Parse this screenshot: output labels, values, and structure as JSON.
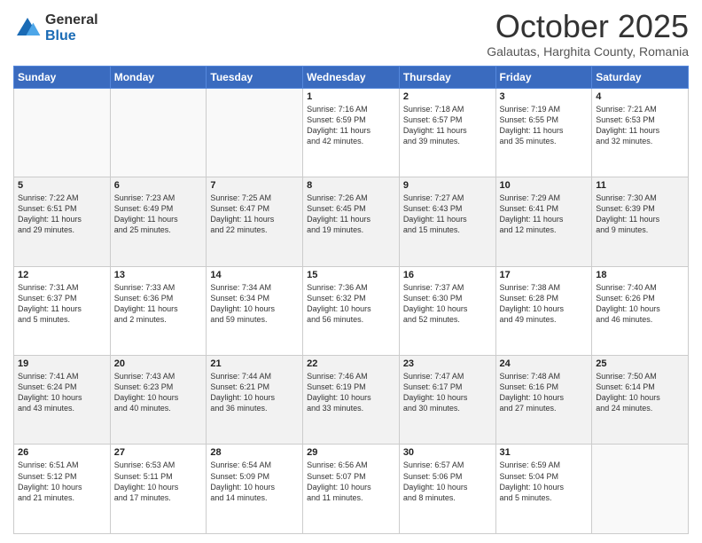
{
  "logo": {
    "general": "General",
    "blue": "Blue"
  },
  "header": {
    "month": "October 2025",
    "location": "Galautas, Harghita County, Romania"
  },
  "weekdays": [
    "Sunday",
    "Monday",
    "Tuesday",
    "Wednesday",
    "Thursday",
    "Friday",
    "Saturday"
  ],
  "weeks": [
    [
      {
        "day": "",
        "info": ""
      },
      {
        "day": "",
        "info": ""
      },
      {
        "day": "",
        "info": ""
      },
      {
        "day": "1",
        "info": "Sunrise: 7:16 AM\nSunset: 6:59 PM\nDaylight: 11 hours\nand 42 minutes."
      },
      {
        "day": "2",
        "info": "Sunrise: 7:18 AM\nSunset: 6:57 PM\nDaylight: 11 hours\nand 39 minutes."
      },
      {
        "day": "3",
        "info": "Sunrise: 7:19 AM\nSunset: 6:55 PM\nDaylight: 11 hours\nand 35 minutes."
      },
      {
        "day": "4",
        "info": "Sunrise: 7:21 AM\nSunset: 6:53 PM\nDaylight: 11 hours\nand 32 minutes."
      }
    ],
    [
      {
        "day": "5",
        "info": "Sunrise: 7:22 AM\nSunset: 6:51 PM\nDaylight: 11 hours\nand 29 minutes."
      },
      {
        "day": "6",
        "info": "Sunrise: 7:23 AM\nSunset: 6:49 PM\nDaylight: 11 hours\nand 25 minutes."
      },
      {
        "day": "7",
        "info": "Sunrise: 7:25 AM\nSunset: 6:47 PM\nDaylight: 11 hours\nand 22 minutes."
      },
      {
        "day": "8",
        "info": "Sunrise: 7:26 AM\nSunset: 6:45 PM\nDaylight: 11 hours\nand 19 minutes."
      },
      {
        "day": "9",
        "info": "Sunrise: 7:27 AM\nSunset: 6:43 PM\nDaylight: 11 hours\nand 15 minutes."
      },
      {
        "day": "10",
        "info": "Sunrise: 7:29 AM\nSunset: 6:41 PM\nDaylight: 11 hours\nand 12 minutes."
      },
      {
        "day": "11",
        "info": "Sunrise: 7:30 AM\nSunset: 6:39 PM\nDaylight: 11 hours\nand 9 minutes."
      }
    ],
    [
      {
        "day": "12",
        "info": "Sunrise: 7:31 AM\nSunset: 6:37 PM\nDaylight: 11 hours\nand 5 minutes."
      },
      {
        "day": "13",
        "info": "Sunrise: 7:33 AM\nSunset: 6:36 PM\nDaylight: 11 hours\nand 2 minutes."
      },
      {
        "day": "14",
        "info": "Sunrise: 7:34 AM\nSunset: 6:34 PM\nDaylight: 10 hours\nand 59 minutes."
      },
      {
        "day": "15",
        "info": "Sunrise: 7:36 AM\nSunset: 6:32 PM\nDaylight: 10 hours\nand 56 minutes."
      },
      {
        "day": "16",
        "info": "Sunrise: 7:37 AM\nSunset: 6:30 PM\nDaylight: 10 hours\nand 52 minutes."
      },
      {
        "day": "17",
        "info": "Sunrise: 7:38 AM\nSunset: 6:28 PM\nDaylight: 10 hours\nand 49 minutes."
      },
      {
        "day": "18",
        "info": "Sunrise: 7:40 AM\nSunset: 6:26 PM\nDaylight: 10 hours\nand 46 minutes."
      }
    ],
    [
      {
        "day": "19",
        "info": "Sunrise: 7:41 AM\nSunset: 6:24 PM\nDaylight: 10 hours\nand 43 minutes."
      },
      {
        "day": "20",
        "info": "Sunrise: 7:43 AM\nSunset: 6:23 PM\nDaylight: 10 hours\nand 40 minutes."
      },
      {
        "day": "21",
        "info": "Sunrise: 7:44 AM\nSunset: 6:21 PM\nDaylight: 10 hours\nand 36 minutes."
      },
      {
        "day": "22",
        "info": "Sunrise: 7:46 AM\nSunset: 6:19 PM\nDaylight: 10 hours\nand 33 minutes."
      },
      {
        "day": "23",
        "info": "Sunrise: 7:47 AM\nSunset: 6:17 PM\nDaylight: 10 hours\nand 30 minutes."
      },
      {
        "day": "24",
        "info": "Sunrise: 7:48 AM\nSunset: 6:16 PM\nDaylight: 10 hours\nand 27 minutes."
      },
      {
        "day": "25",
        "info": "Sunrise: 7:50 AM\nSunset: 6:14 PM\nDaylight: 10 hours\nand 24 minutes."
      }
    ],
    [
      {
        "day": "26",
        "info": "Sunrise: 6:51 AM\nSunset: 5:12 PM\nDaylight: 10 hours\nand 21 minutes."
      },
      {
        "day": "27",
        "info": "Sunrise: 6:53 AM\nSunset: 5:11 PM\nDaylight: 10 hours\nand 17 minutes."
      },
      {
        "day": "28",
        "info": "Sunrise: 6:54 AM\nSunset: 5:09 PM\nDaylight: 10 hours\nand 14 minutes."
      },
      {
        "day": "29",
        "info": "Sunrise: 6:56 AM\nSunset: 5:07 PM\nDaylight: 10 hours\nand 11 minutes."
      },
      {
        "day": "30",
        "info": "Sunrise: 6:57 AM\nSunset: 5:06 PM\nDaylight: 10 hours\nand 8 minutes."
      },
      {
        "day": "31",
        "info": "Sunrise: 6:59 AM\nSunset: 5:04 PM\nDaylight: 10 hours\nand 5 minutes."
      },
      {
        "day": "",
        "info": ""
      }
    ]
  ]
}
